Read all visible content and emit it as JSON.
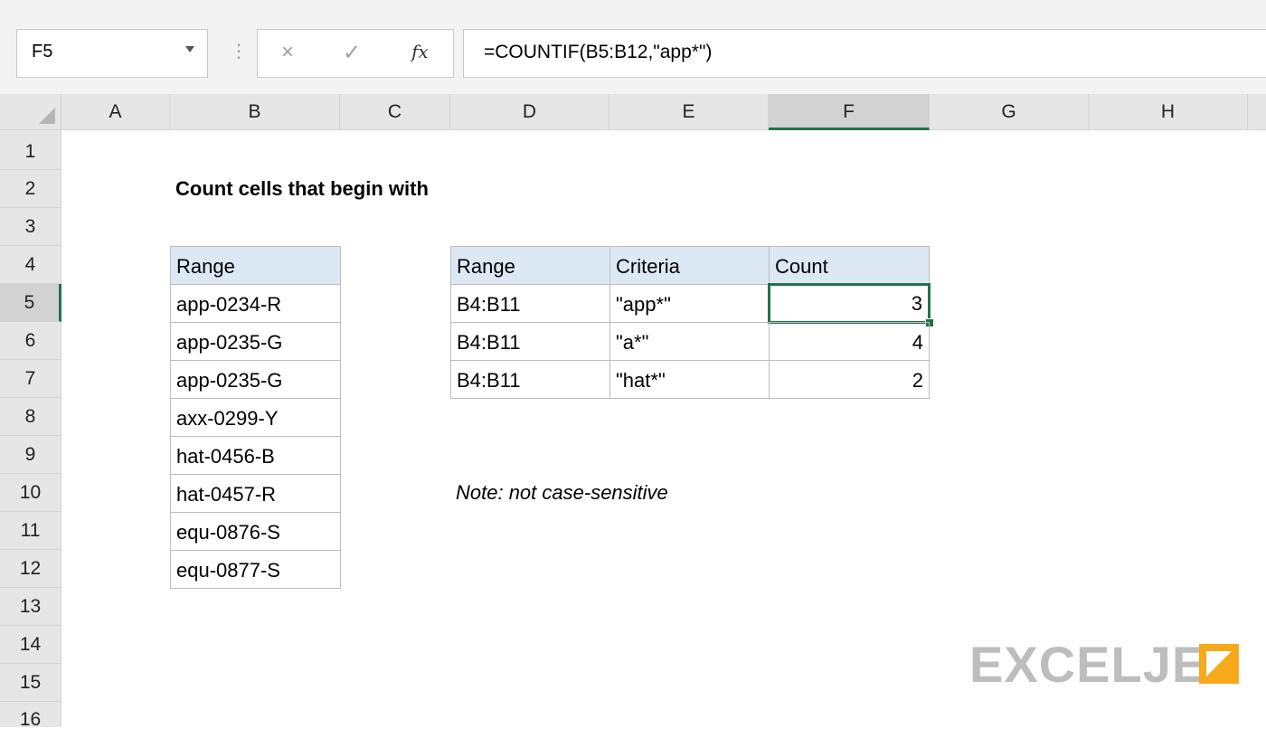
{
  "formula_bar": {
    "name_box": "F5",
    "cancel_icon": "×",
    "enter_icon": "✓",
    "fx_label": "fx",
    "formula": "=COUNTIF(B5:B12,\"app*\")"
  },
  "columns": [
    "A",
    "B",
    "C",
    "D",
    "E",
    "F",
    "G",
    "H"
  ],
  "rows": [
    "1",
    "2",
    "3",
    "4",
    "5",
    "6",
    "7",
    "8",
    "9",
    "10",
    "11",
    "12",
    "13",
    "14",
    "15",
    "16"
  ],
  "sheet": {
    "title": "Count cells that begin with",
    "range_header": "Range",
    "range_values": [
      "app-0234-R",
      "app-0235-G",
      "app-0235-G",
      "axx-0299-Y",
      "hat-0456-B",
      "hat-0457-R",
      "equ-0876-S",
      "equ-0877-S"
    ],
    "summary_headers": [
      "Range",
      "Criteria",
      "Count"
    ],
    "summary_rows": [
      {
        "range": "B4:B11",
        "criteria": "\"app*\"",
        "count": "3"
      },
      {
        "range": "B4:B11",
        "criteria": "\"a*\"",
        "count": "4"
      },
      {
        "range": "B4:B11",
        "criteria": "\"hat*\"",
        "count": "2"
      }
    ],
    "note": "Note: not case-sensitive"
  },
  "logo": {
    "text": "EXCELJET"
  },
  "colors": {
    "accent": "#217346",
    "header_fill": "#dde8f5",
    "logo_orange": "#f7a81b"
  }
}
